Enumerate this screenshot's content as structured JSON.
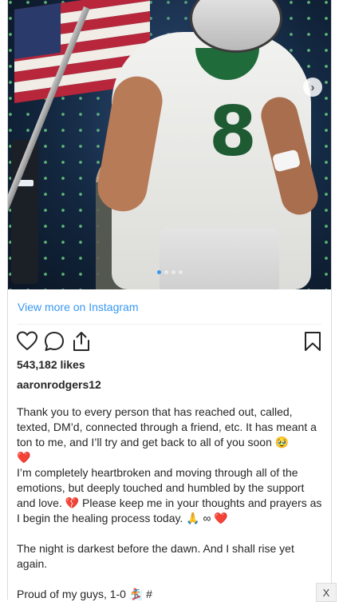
{
  "post": {
    "view_more": "View more on Instagram",
    "likes": "543,182 likes",
    "username": "aaronrodgers12",
    "caption": [
      "Thank you to every person that has reached out, called, texted, DM’d, connected through a friend, etc. It has meant a ton to me, and I’ll try and get back to all of you soon 🥹",
      "❤️",
      "I’m completely heartbroken and moving through all of the emotions, but deeply touched and humbled by the support and love. 💔 Please keep me in your thoughts and prayers as I begin the healing process today. 🙏 ∞ ❤️",
      "",
      "The night is darkest before the dawn. And I shall rise yet again.",
      "",
      "Proud of my guys, 1-0 🏂 #"
    ],
    "jersey_number": "8",
    "next_glyph": "›",
    "close_glyph": "X"
  },
  "colors": {
    "link": "#3897f0",
    "text": "#262626",
    "jersey_green": "#1e5b33"
  },
  "carousel": {
    "slide_count": 4,
    "active_index": 0
  },
  "icons": [
    "heart-icon",
    "comment-icon",
    "share-icon",
    "bookmark-icon",
    "chevron-right-icon",
    "close-icon"
  ]
}
